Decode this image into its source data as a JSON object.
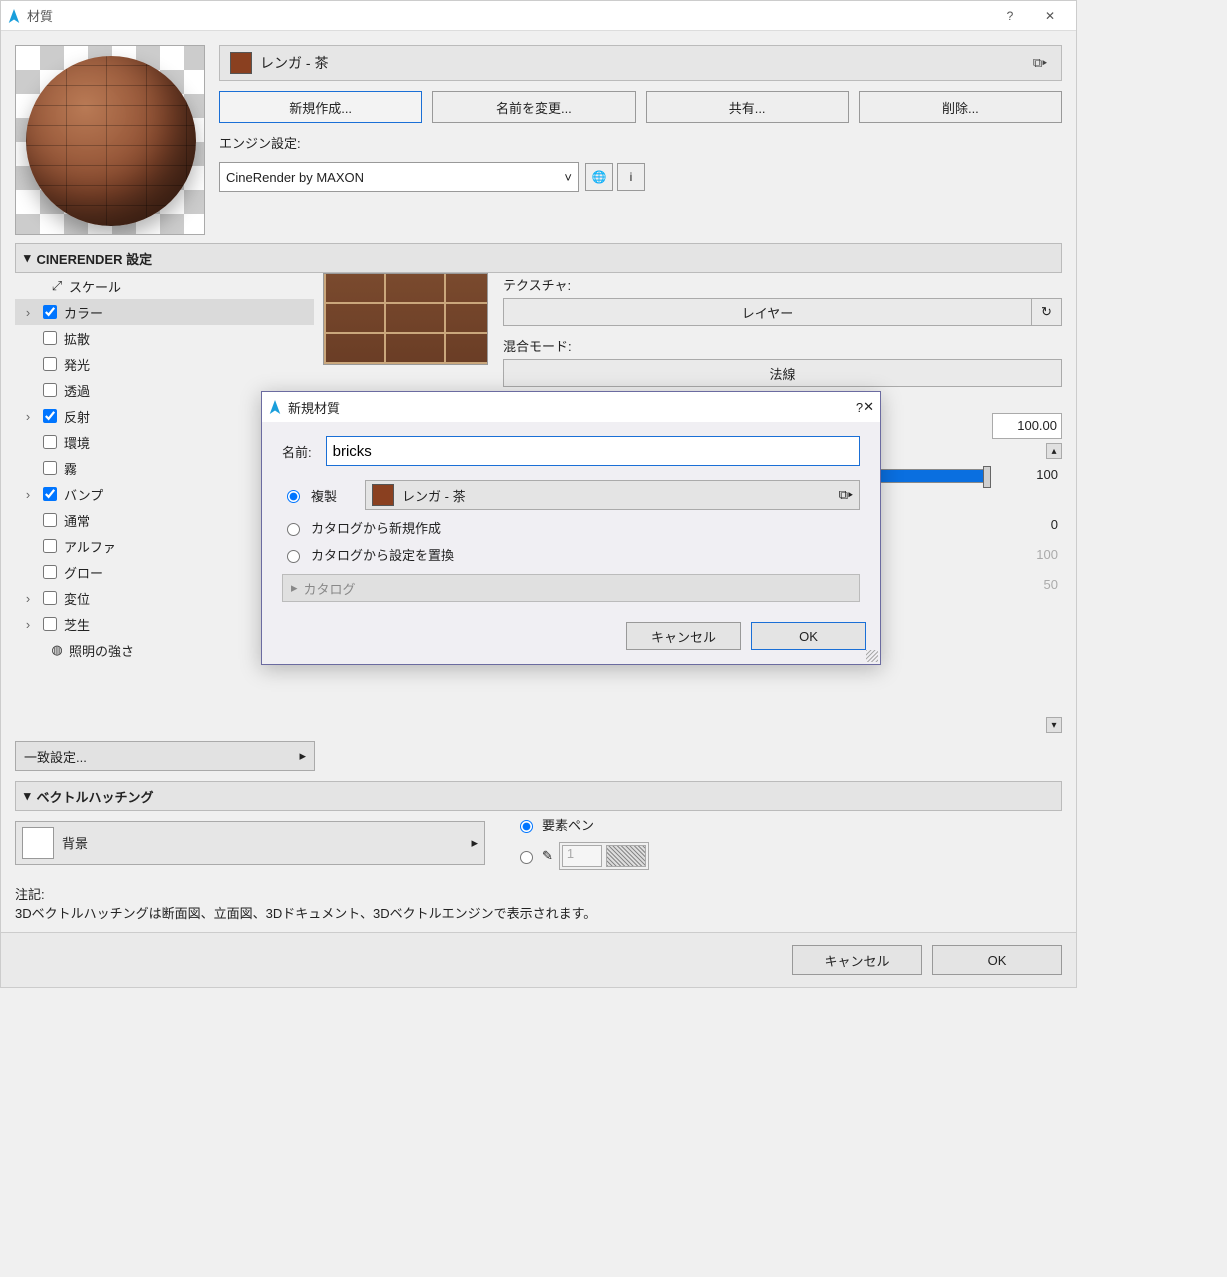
{
  "window": {
    "title": "材質",
    "help": "?",
    "close": "✕"
  },
  "material": {
    "name": "レンガ - 茶",
    "buttons": {
      "new": "新規作成...",
      "rename": "名前を変更...",
      "share": "共有...",
      "delete": "削除..."
    }
  },
  "engine": {
    "label": "エンジン設定:",
    "selected": "CineRender by MAXON",
    "info": "i"
  },
  "sections": {
    "cinerender": "CINERENDER 設定",
    "match_settings": "一致設定...",
    "vector_hatch": "ベクトルハッチング"
  },
  "tree": {
    "scale": "スケール",
    "color": "カラー",
    "diffuse": "拡散",
    "emission": "発光",
    "transparency": "透過",
    "reflect": "反射",
    "env": "環境",
    "fog": "霧",
    "bump": "バンプ",
    "normal": "通常",
    "alpha": "アルファ",
    "glow": "グロー",
    "disp": "変位",
    "grass": "芝生",
    "illum": "照明の強さ"
  },
  "detail": {
    "texture_label": "テクスチャ:",
    "texture_value": "レイヤー",
    "blend_label": "混合モード:",
    "blend_value": "法線",
    "num1": "100.00",
    "num2": "100",
    "num3": "0",
    "num4": "100",
    "num5": "50"
  },
  "hatch": {
    "dropdown": "背景",
    "radio_element_pen": "要素ペン",
    "pen_number": "1"
  },
  "note": {
    "label": "注記:",
    "text": "3Dベクトルハッチングは断面図、立面図、3Dドキュメント、3Dベクトルエンジンで表示されます。"
  },
  "footer": {
    "cancel": "キャンセル",
    "ok": "OK"
  },
  "modal": {
    "title": "新規材質",
    "help": "?",
    "close": "✕",
    "name_label": "名前:",
    "name_value": "bricks",
    "radio_duplicate": "複製",
    "dup_value": "レンガ - 茶",
    "radio_from_catalog": "カタログから新規作成",
    "radio_replace_catalog": "カタログから設定を置換",
    "catalog_header": "カタログ",
    "cancel": "キャンセル",
    "ok": "OK"
  }
}
